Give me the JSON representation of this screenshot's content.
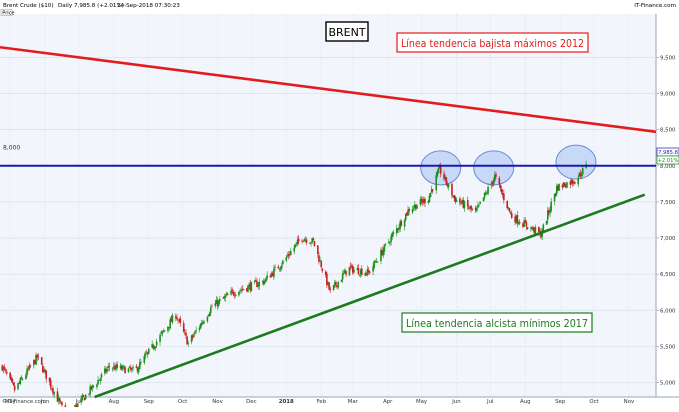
{
  "header": {
    "title": "Brent Crude ($10)",
    "interval": "Daily",
    "quote": "7,985.8 (+2.01%)",
    "timestamp": "24-Sep-2018 07:30:23",
    "source": "IT-Finance.com"
  },
  "price_label": "Price",
  "level_label": "8,000",
  "price_badge": "7,985.8",
  "change_badge": "+2.01%",
  "watermark": "©IT-Finance.com",
  "annotations": {
    "brent_box": "BRENT",
    "bear_line": "Línea tendencia bajista máximos 2012",
    "bull_line": "Línea tendencia alcista mínimos 2017"
  },
  "colors": {
    "up": "#1a8f1a",
    "down": "#c81e1e",
    "bear_line": "#e31b1b",
    "bull_line": "#1d7a1d",
    "level_line": "#1a1aa8",
    "circle_fill": "#b9cdf5",
    "circle_stroke": "#6a8ad6"
  },
  "chart_data": {
    "type": "candlestick",
    "title": "Brent Crude ($10)",
    "ylim": [
      4800,
      10100
    ],
    "y_ticks": [
      "5,000",
      "5,500",
      "6,000",
      "6,500",
      "7,000",
      "7,500",
      "8,000",
      "8,500",
      "9,000",
      "9,500"
    ],
    "x_labels": [
      "May",
      "Jun",
      "Jul",
      "Aug",
      "Sep",
      "Oct",
      "Nov",
      "Dec",
      "2018",
      "Feb",
      "Mar",
      "Apr",
      "May",
      "Jun",
      "Jul",
      "Aug",
      "Sep",
      "Oct",
      "Nov"
    ],
    "x_dates": [
      "2017-05-01",
      "2017-06-01",
      "2017-07-01",
      "2017-08-01",
      "2017-09-01",
      "2017-10-01",
      "2017-11-01",
      "2017-12-01",
      "2018-01-01",
      "2018-02-01",
      "2018-03-01",
      "2018-04-01",
      "2018-05-01",
      "2018-06-01",
      "2018-07-01",
      "2018-08-01",
      "2018-09-01",
      "2018-10-01",
      "2018-11-01"
    ],
    "xlim": [
      "2017-04-22",
      "2018-11-25"
    ],
    "close_path": [
      {
        "date": "2017-04-24",
        "close": 5220
      },
      {
        "date": "2017-05-05",
        "close": 4900
      },
      {
        "date": "2017-05-25",
        "close": 5350
      },
      {
        "date": "2017-06-20",
        "close": 4520
      },
      {
        "date": "2017-07-05",
        "close": 4780
      },
      {
        "date": "2017-07-28",
        "close": 5220
      },
      {
        "date": "2017-08-20",
        "close": 5160
      },
      {
        "date": "2017-09-25",
        "close": 5940
      },
      {
        "date": "2017-10-06",
        "close": 5540
      },
      {
        "date": "2017-10-27",
        "close": 6050
      },
      {
        "date": "2017-11-15",
        "close": 6250
      },
      {
        "date": "2017-12-12",
        "close": 6400
      },
      {
        "date": "2017-12-28",
        "close": 6650
      },
      {
        "date": "2018-01-15",
        "close": 7010
      },
      {
        "date": "2018-01-25",
        "close": 6950
      },
      {
        "date": "2018-02-09",
        "close": 6250
      },
      {
        "date": "2018-02-25",
        "close": 6580
      },
      {
        "date": "2018-03-15",
        "close": 6520
      },
      {
        "date": "2018-04-10",
        "close": 7150
      },
      {
        "date": "2018-04-20",
        "close": 7400
      },
      {
        "date": "2018-05-07",
        "close": 7550
      },
      {
        "date": "2018-05-17",
        "close": 7950
      },
      {
        "date": "2018-05-30",
        "close": 7550
      },
      {
        "date": "2018-06-18",
        "close": 7350
      },
      {
        "date": "2018-07-05",
        "close": 7850
      },
      {
        "date": "2018-07-20",
        "close": 7300
      },
      {
        "date": "2018-08-15",
        "close": 7050
      },
      {
        "date": "2018-08-29",
        "close": 7700
      },
      {
        "date": "2018-09-14",
        "close": 7800
      },
      {
        "date": "2018-09-24",
        "close": 7986
      }
    ],
    "reference_lines": [
      {
        "name": "resistance",
        "value": 8000
      }
    ],
    "trend_lines": [
      {
        "name": "bear",
        "from": {
          "date": "2017-04-22",
          "value": 9640
        },
        "to": {
          "date": "2018-11-25",
          "value": 8470
        }
      },
      {
        "name": "bull",
        "from": {
          "date": "2017-07-15",
          "value": 4800
        },
        "to": {
          "date": "2018-11-15",
          "value": 7600
        }
      }
    ],
    "highlight_circles": [
      {
        "date": "2018-05-18",
        "value": 7970
      },
      {
        "date": "2018-07-04",
        "value": 7970
      },
      {
        "date": "2018-09-15",
        "value": 8050
      }
    ],
    "grid": true,
    "price_axis": "right"
  }
}
